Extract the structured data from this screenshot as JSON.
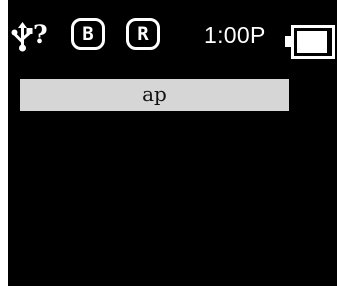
{
  "status_bar": {
    "usb_icon": "usb-icon",
    "unknown_status": "?",
    "badge_b": "B",
    "badge_r": "R",
    "clock": "1:00P",
    "battery": {
      "icon": "battery-icon",
      "level_fraction": 0.93
    }
  },
  "main": {
    "input": {
      "value": "ap"
    }
  },
  "colors": {
    "background": "#000000",
    "foreground": "#ffffff",
    "field_background": "#d6d6d6",
    "field_text": "#111111"
  }
}
